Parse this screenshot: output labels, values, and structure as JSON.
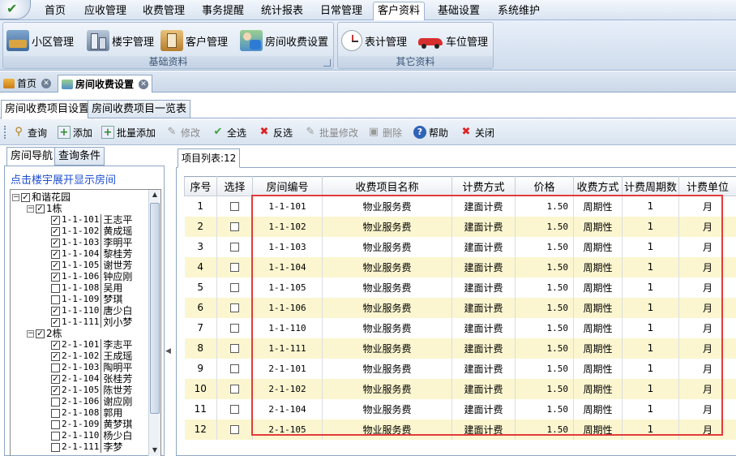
{
  "menu": {
    "tabs": [
      {
        "label": "首页"
      },
      {
        "label": "应收管理"
      },
      {
        "label": "收费管理"
      },
      {
        "label": "事务提醒"
      },
      {
        "label": "统计报表"
      },
      {
        "label": "日常管理"
      },
      {
        "label": "客户资料"
      },
      {
        "label": "基础设置"
      },
      {
        "label": "系统维护"
      }
    ],
    "active": "客户资料"
  },
  "ribbon": {
    "group_basic": {
      "label": "基础资料",
      "buttons": [
        {
          "label": "小区管理",
          "icon": "building-complex-icon"
        },
        {
          "label": "楼宇管理",
          "icon": "buildings-icon"
        },
        {
          "label": "客户管理",
          "icon": "customer-icon"
        },
        {
          "label": "房间收费设置",
          "icon": "room-fee-icon"
        }
      ]
    },
    "group_other": {
      "label": "其它资料",
      "buttons": [
        {
          "label": "表计管理",
          "icon": "meter-clock-icon"
        },
        {
          "label": "车位管理",
          "icon": "car-icon"
        }
      ]
    }
  },
  "doc_tabs": [
    {
      "label": "首页",
      "icon": "home-icon"
    },
    {
      "label": "房间收费设置",
      "icon": "room-fee-icon",
      "active": true
    }
  ],
  "sub_tabs": [
    {
      "label": "房间收费项目设置",
      "active": true
    },
    {
      "label": "房间收费项目一览表"
    }
  ],
  "toolbar": {
    "buttons": [
      {
        "label": "查询",
        "icon": "search-icon",
        "enabled": true
      },
      {
        "label": "添加",
        "icon": "add-icon",
        "enabled": true
      },
      {
        "label": "批量添加",
        "icon": "batch-add-icon",
        "enabled": true
      },
      {
        "label": "修改",
        "icon": "edit-icon",
        "enabled": false
      },
      {
        "label": "全选",
        "icon": "check-icon",
        "enabled": true
      },
      {
        "label": "反选",
        "icon": "cross-icon",
        "enabled": true
      },
      {
        "label": "批量修改",
        "icon": "batch-edit-icon",
        "enabled": false
      },
      {
        "label": "删除",
        "icon": "delete-icon",
        "enabled": false
      },
      {
        "label": "帮助",
        "icon": "help-icon",
        "enabled": true
      },
      {
        "label": "关闭",
        "icon": "close-icon",
        "enabled": true
      }
    ]
  },
  "left_panel": {
    "tabs": [
      {
        "label": "房间导航"
      },
      {
        "label": "查询条件"
      }
    ],
    "hint": "点击楼宇展开显示房间",
    "tree": [
      {
        "level": 0,
        "expander": "-",
        "checked": true,
        "text": "和谐花园"
      },
      {
        "level": 1,
        "expander": "-",
        "checked": true,
        "text": "1栋"
      },
      {
        "level": 2,
        "checked": true,
        "code": "1-1-101",
        "name": "王志平"
      },
      {
        "level": 2,
        "checked": true,
        "code": "1-1-102",
        "name": "黄成瑶"
      },
      {
        "level": 2,
        "checked": true,
        "code": "1-1-103",
        "name": "李明平"
      },
      {
        "level": 2,
        "checked": true,
        "code": "1-1-104",
        "name": "黎桂芳"
      },
      {
        "level": 2,
        "checked": true,
        "code": "1-1-105",
        "name": "谢世芳"
      },
      {
        "level": 2,
        "checked": true,
        "code": "1-1-106",
        "name": "钟应刚"
      },
      {
        "level": 2,
        "checked": false,
        "code": "1-1-108",
        "name": "吴用"
      },
      {
        "level": 2,
        "checked": false,
        "code": "1-1-109",
        "name": "梦琪"
      },
      {
        "level": 2,
        "checked": true,
        "code": "1-1-110",
        "name": "唐少白"
      },
      {
        "level": 2,
        "checked": true,
        "code": "1-1-111",
        "name": "刘小梦"
      },
      {
        "level": 1,
        "expander": "-",
        "checked": true,
        "text": "2栋"
      },
      {
        "level": 2,
        "checked": true,
        "code": "2-1-101",
        "name": "李志平"
      },
      {
        "level": 2,
        "checked": true,
        "code": "2-1-102",
        "name": "王成瑶"
      },
      {
        "level": 2,
        "checked": false,
        "code": "2-1-103",
        "name": "陶明平"
      },
      {
        "level": 2,
        "checked": true,
        "code": "2-1-104",
        "name": "张桂芳"
      },
      {
        "level": 2,
        "checked": true,
        "code": "2-1-105",
        "name": "陈世芳"
      },
      {
        "level": 2,
        "checked": false,
        "code": "2-1-106",
        "name": "谢应刚"
      },
      {
        "level": 2,
        "checked": false,
        "code": "2-1-108",
        "name": "郭用"
      },
      {
        "level": 2,
        "checked": false,
        "code": "2-1-109",
        "name": "黄梦琪"
      },
      {
        "level": 2,
        "checked": false,
        "code": "2-1-110",
        "name": "杨少白"
      },
      {
        "level": 2,
        "checked": false,
        "code": "2-1-111",
        "name": "李梦"
      }
    ]
  },
  "right_panel": {
    "tab_label": "项目列表:12",
    "columns": [
      "序号",
      "选择",
      "房间编号",
      "收费项目名称",
      "计费方式",
      "价格",
      "收费方式",
      "计费周期数",
      "计费单位"
    ],
    "rows": [
      [
        "1",
        false,
        "1-1-101",
        "物业服务费",
        "建面计费",
        "1.50",
        "周期性",
        "1",
        "月"
      ],
      [
        "2",
        false,
        "1-1-102",
        "物业服务费",
        "建面计费",
        "1.50",
        "周期性",
        "1",
        "月"
      ],
      [
        "3",
        false,
        "1-1-103",
        "物业服务费",
        "建面计费",
        "1.50",
        "周期性",
        "1",
        "月"
      ],
      [
        "4",
        false,
        "1-1-104",
        "物业服务费",
        "建面计费",
        "1.50",
        "周期性",
        "1",
        "月"
      ],
      [
        "5",
        false,
        "1-1-105",
        "物业服务费",
        "建面计费",
        "1.50",
        "周期性",
        "1",
        "月"
      ],
      [
        "6",
        false,
        "1-1-106",
        "物业服务费",
        "建面计费",
        "1.50",
        "周期性",
        "1",
        "月"
      ],
      [
        "7",
        false,
        "1-1-110",
        "物业服务费",
        "建面计费",
        "1.50",
        "周期性",
        "1",
        "月"
      ],
      [
        "8",
        false,
        "1-1-111",
        "物业服务费",
        "建面计费",
        "1.50",
        "周期性",
        "1",
        "月"
      ],
      [
        "9",
        false,
        "2-1-101",
        "物业服务费",
        "建面计费",
        "1.50",
        "周期性",
        "1",
        "月"
      ],
      [
        "10",
        false,
        "2-1-102",
        "物业服务费",
        "建面计费",
        "1.50",
        "周期性",
        "1",
        "月"
      ],
      [
        "11",
        false,
        "2-1-104",
        "物业服务费",
        "建面计费",
        "1.50",
        "周期性",
        "1",
        "月"
      ],
      [
        "12",
        false,
        "2-1-105",
        "物业服务费",
        "建面计费",
        "1.50",
        "周期性",
        "1",
        "月"
      ]
    ]
  },
  "colors": {
    "accent": "#1e4fd1",
    "row_alt": "#fbf6cf",
    "highlight_border": "#e23b3b",
    "ribbon": "#d5e1ef"
  }
}
